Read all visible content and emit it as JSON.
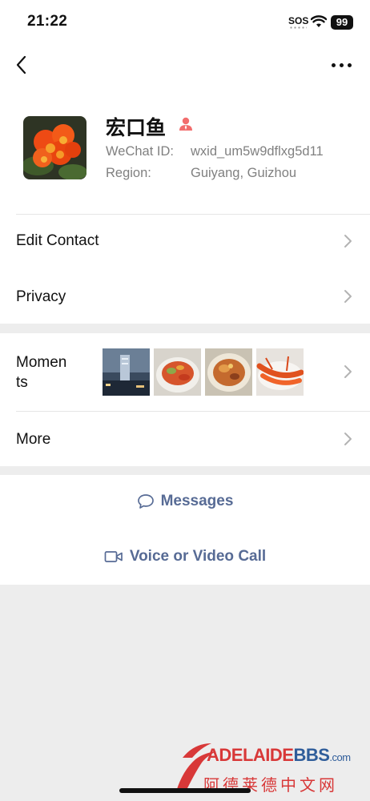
{
  "status_bar": {
    "time": "21:22",
    "sos": "SOS",
    "battery": "99"
  },
  "nav": {
    "back_icon": "chevron-left-icon",
    "more_icon": "more-dots-icon"
  },
  "profile": {
    "name": "宏口鱼",
    "wechat_id_label": "WeChat ID:",
    "wechat_id_value": "wxid_um5w9dflxg5d11",
    "region_label": "Region:",
    "region_value": "Guiyang, Guizhou",
    "badge_icon": "person-icon",
    "badge_color": "#f26d6d"
  },
  "rows": {
    "edit_contact": "Edit Contact",
    "privacy": "Privacy",
    "moments": "Momen\nts",
    "more": "More"
  },
  "actions": {
    "messages": "Messages",
    "call": "Voice or Video Call",
    "link_color": "#576b95"
  },
  "watermark": {
    "brand_red": "ADELAIDE",
    "brand_blue": "BBS",
    "domain": ".com",
    "chinese": "阿德莱德中文网"
  }
}
